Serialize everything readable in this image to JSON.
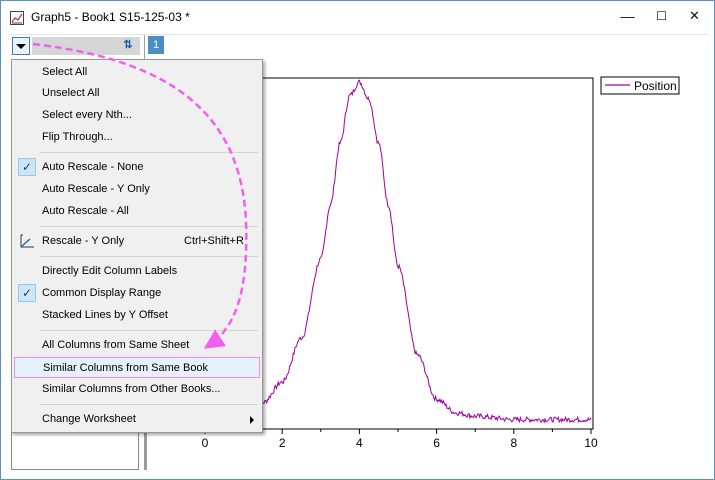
{
  "window": {
    "title": "Graph5 - Book1 S15-125-03 *",
    "minimize": "—",
    "maximize": "☐",
    "close": "✕"
  },
  "panel": {
    "layer_number": "1",
    "sort_icon": "sort-icon"
  },
  "menu": {
    "items": [
      {
        "label": "Select All"
      },
      {
        "label": "Unselect All"
      },
      {
        "label": "Select every Nth..."
      },
      {
        "label": "Flip Through..."
      },
      {
        "label": "Auto Rescale - None",
        "checked": true
      },
      {
        "label": "Auto Rescale - Y Only"
      },
      {
        "label": "Auto Rescale - All"
      },
      {
        "label": "Rescale - Y Only",
        "shortcut": "Ctrl+Shift+R",
        "icon": "rescale-icon"
      },
      {
        "label": "Directly Edit Column Labels"
      },
      {
        "label": "Common Display Range",
        "checked": true
      },
      {
        "label": "Stacked Lines by Y Offset"
      },
      {
        "label": "All Columns from Same Sheet"
      },
      {
        "label": "Similar Columns from Same Book",
        "highlighted": true
      },
      {
        "label": "Similar Columns from Other Books..."
      },
      {
        "label": "Change Worksheet",
        "submenu": true
      }
    ]
  },
  "graph": {
    "legend": "Position",
    "x_ticks": [
      "0",
      "2",
      "4",
      "6",
      "8",
      "10"
    ],
    "line_color": "#a000a0"
  },
  "chart_data": {
    "type": "line",
    "series": [
      {
        "name": "Position",
        "color": "#a000a0"
      }
    ],
    "xlim": [
      0,
      10
    ],
    "x_ticks": [
      0,
      2,
      4,
      6,
      8,
      10
    ],
    "y_axis_visible": false,
    "legend_position": "top-right",
    "x": [
      0,
      0.5,
      1,
      1.5,
      2,
      2.5,
      3,
      3.25,
      3.5,
      3.75,
      4,
      4.25,
      4.5,
      4.75,
      5,
      5.5,
      6,
      6.5,
      7,
      8,
      9,
      10
    ],
    "y": [
      0.01,
      0.02,
      0.03,
      0.06,
      0.12,
      0.25,
      0.48,
      0.64,
      0.82,
      0.96,
      1.0,
      0.95,
      0.82,
      0.64,
      0.46,
      0.2,
      0.07,
      0.03,
      0.02,
      0.01,
      0.01,
      0.01
    ]
  }
}
